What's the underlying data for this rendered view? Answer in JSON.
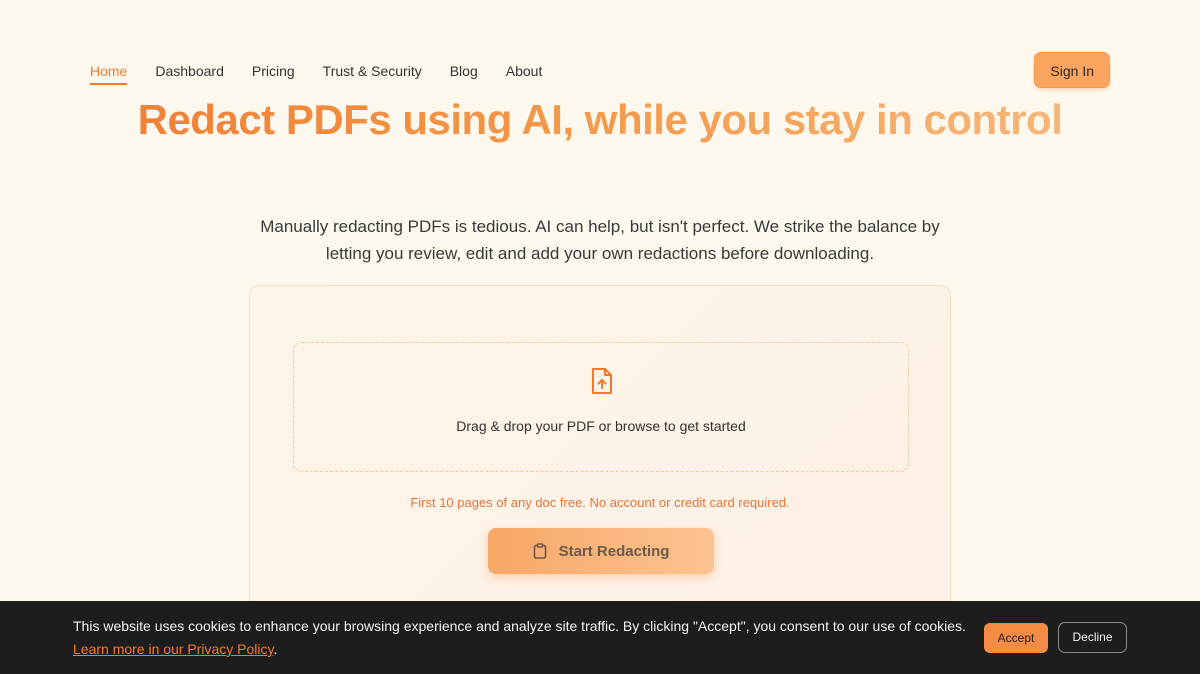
{
  "nav": {
    "links": [
      {
        "label": "Home",
        "active": true
      },
      {
        "label": "Dashboard"
      },
      {
        "label": "Pricing"
      },
      {
        "label": "Trust & Security"
      },
      {
        "label": "Blog"
      },
      {
        "label": "About"
      }
    ],
    "signin_label": "Sign In"
  },
  "hero": {
    "title": "Redact PDFs using AI, while you stay in control",
    "subtitle": "Manually redacting PDFs is tedious. AI can help, but isn't perfect. We strike the balance by letting you review, edit and add your own redactions before downloading."
  },
  "upload": {
    "icon": "file-upload-icon",
    "dropzone_text": "Drag & drop your PDF or browse to get started",
    "free_note": "First 10 pages of any doc free. No account or credit card required.",
    "start_label": "Start Redacting",
    "start_icon": "clipboard-icon"
  },
  "cookie": {
    "text": "This website uses cookies to enhance your browsing experience and analyze site traffic. By clicking \"Accept\", you consent to our use of cookies.",
    "link_label": "Learn more in our Privacy Policy",
    "trailing": ".",
    "accept_label": "Accept",
    "decline_label": "Decline"
  },
  "colors": {
    "accent": "#f07a2e",
    "background": "#fdf8ee",
    "cookie_bg": "#1d1d1d"
  }
}
